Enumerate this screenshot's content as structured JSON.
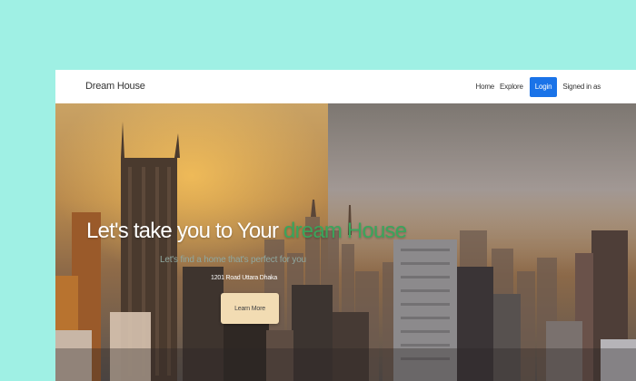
{
  "navbar": {
    "brand": "Dream House",
    "links": {
      "home": "Home",
      "explore": "Explore",
      "login": "Login",
      "signed_in": "Signed in as"
    },
    "login_color": "#1a73e8"
  },
  "hero": {
    "headline_prefix": "Let's take you to Your ",
    "headline_accent": "dream House",
    "accent_color": "#3aa55c",
    "tagline": "Let's find a home that's perfect for you",
    "address": "1201 Road Uttara Dhaka",
    "cta_label": "Learn More",
    "cta_color": "#f2dcb3"
  }
}
